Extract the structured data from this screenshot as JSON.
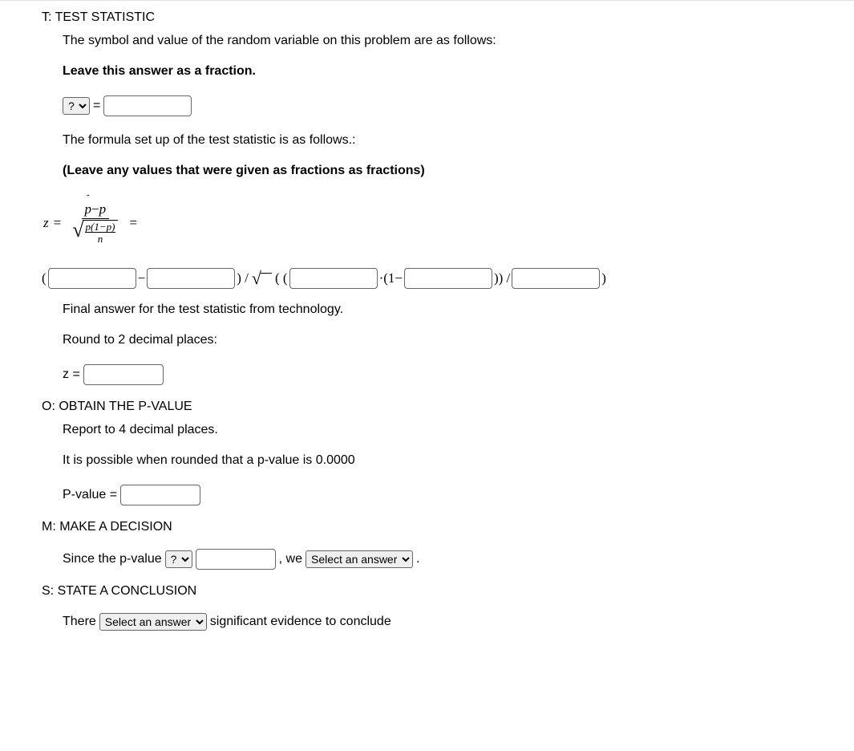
{
  "t": {
    "title": "T: TEST STATISTIC",
    "line1": "The symbol and value of the random variable on this problem are as follows:",
    "line2": "Leave this answer as a fraction.",
    "select_q": "?",
    "eq": "=",
    "line3": "The formula set up of the test statistic is as follows.:",
    "line4": "(Leave any values that were given as fractions as fractions)",
    "formula": {
      "z": "z",
      "eq1": "=",
      "p_hat": "p",
      "minus": " − ",
      "p": "p",
      "p_of": "p(1−p)",
      "n": "n",
      "eq2": "="
    },
    "calc": {
      "open": "(",
      "minus": " − ",
      "close_div": " ) / ",
      "sqrt": "√",
      "open2": "( (",
      "dot_1minus": " ·(1−",
      "close_paren2_div": " )) /",
      "close": " )"
    },
    "line5": "Final answer for the test statistic from technology.",
    "line6": "Round to 2 decimal places:",
    "z_eq": "z ="
  },
  "o": {
    "title": "O: OBTAIN THE P-VALUE",
    "line1": "Report to 4 decimal places.",
    "line2": "It is possible when rounded that a p-value is 0.0000",
    "label": "P-value ="
  },
  "m": {
    "title": "M: MAKE A DECISION",
    "since": "Since the p-value",
    "select_q": "?",
    "we": ", we",
    "select2": "Select an answer",
    "period": "."
  },
  "s": {
    "title": "S: STATE A CONCLUSION",
    "there": "There",
    "select": "Select an answer",
    "rest": "significant evidence to conclude"
  }
}
